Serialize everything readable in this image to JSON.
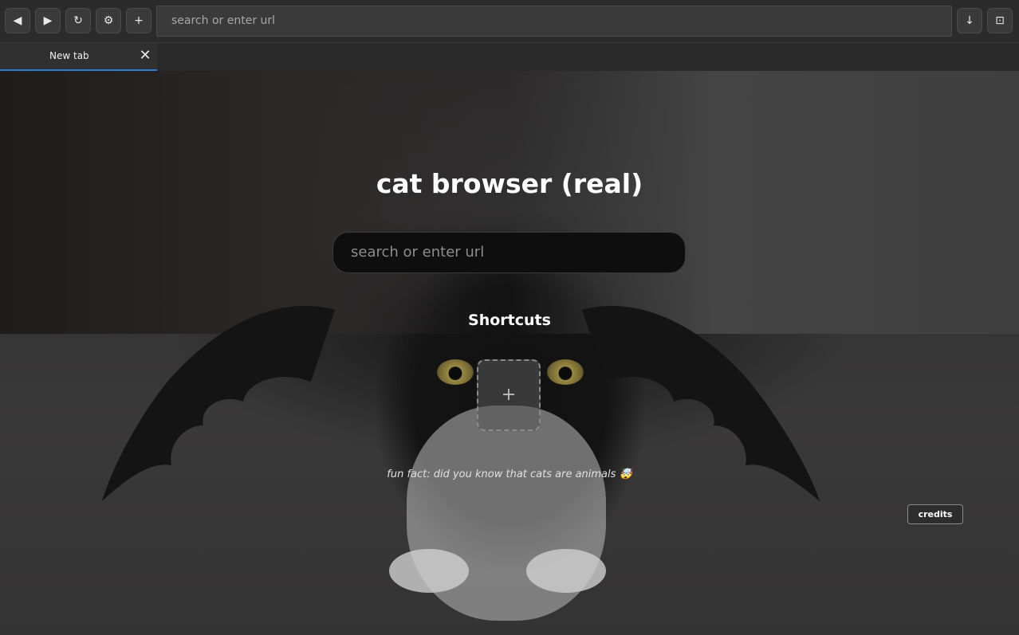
{
  "toolbar": {
    "back_icon": "◀",
    "forward_icon": "▶",
    "reload_icon": "↻",
    "settings_icon": "⚙",
    "new_tab_icon": "+",
    "url_placeholder": "search or enter url",
    "download_icon": "↓",
    "window_icon": "⊡"
  },
  "tabs": [
    {
      "label": "New tab",
      "close_icon": "✕",
      "active": true
    }
  ],
  "page": {
    "title": "cat browser (real)",
    "search_placeholder": "search or enter url",
    "shortcuts_heading": "Shortcuts",
    "add_shortcut_icon": "+",
    "fun_fact": "fun fact: did you know that cats are animals 🤯",
    "credits_label": "credits"
  },
  "colors": {
    "accent": "#2f7fd1",
    "toolbar_bg": "#2b2b2b",
    "button_bg": "#3a3a3a"
  }
}
